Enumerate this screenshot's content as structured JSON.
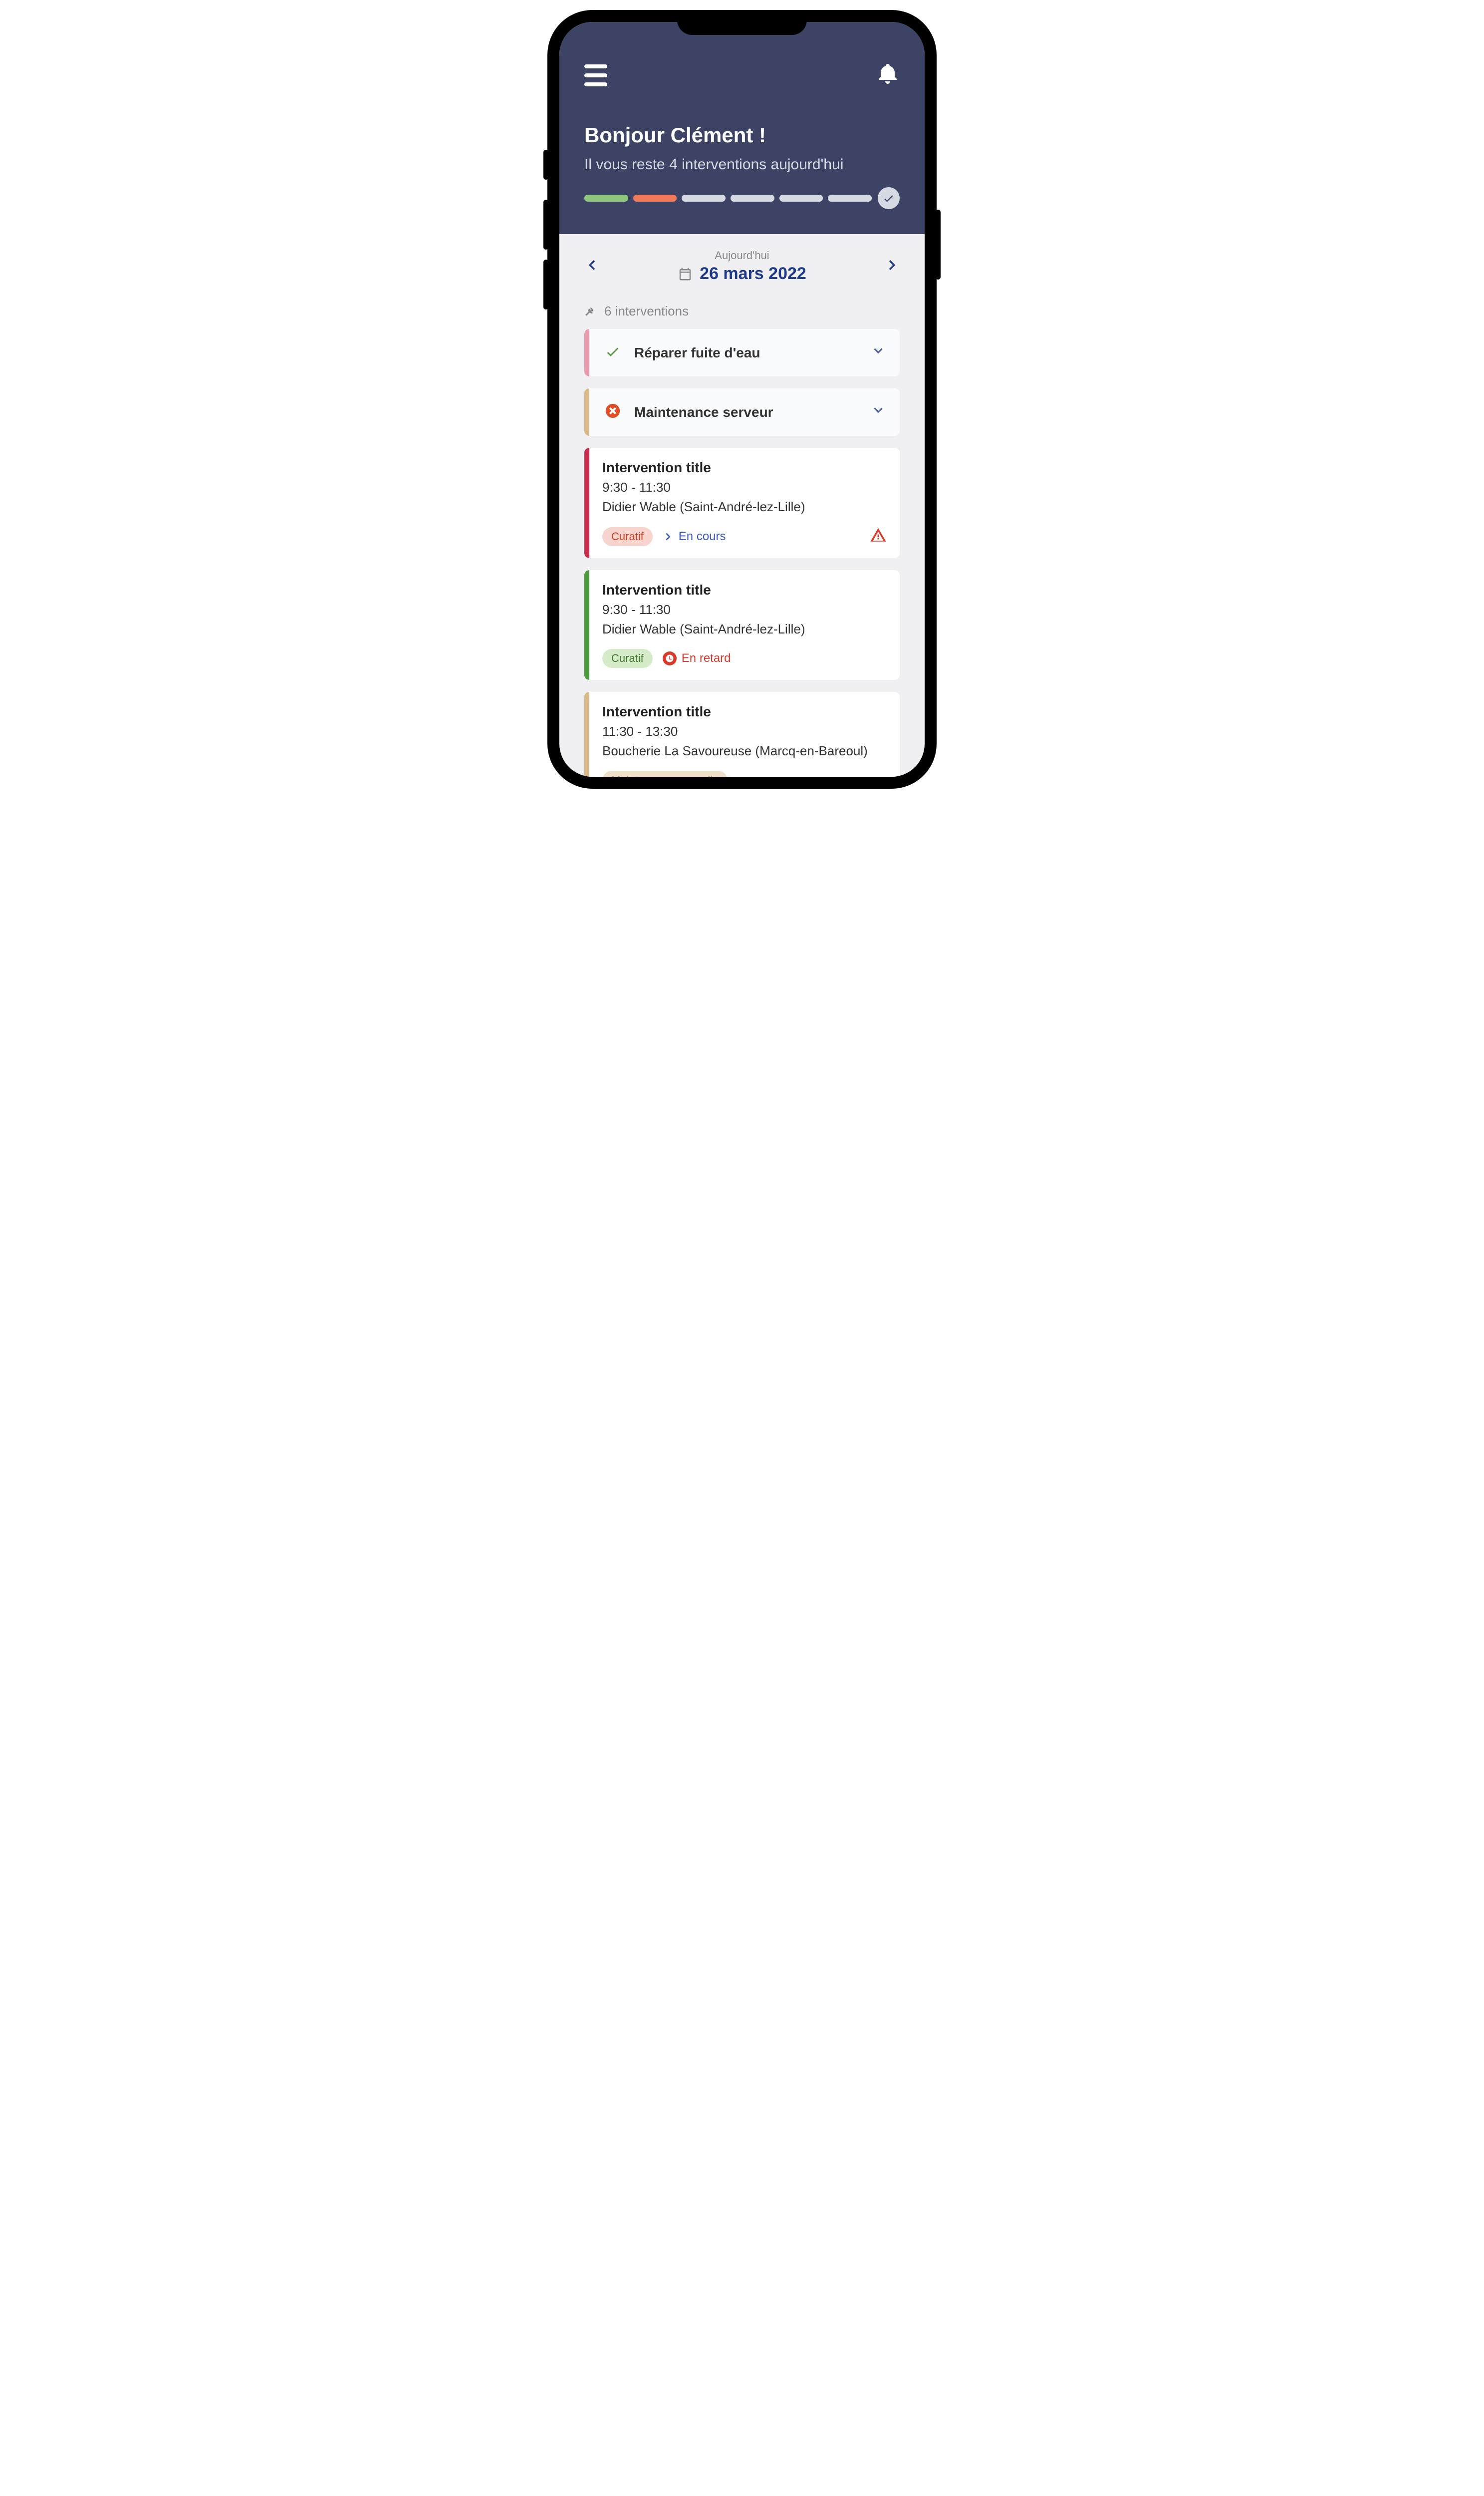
{
  "header": {
    "greeting": "Bonjour Clément !",
    "subtitle": "Il vous reste 4 interventions aujourd'hui",
    "progress": [
      "green",
      "orange",
      "grey",
      "grey",
      "grey",
      "grey"
    ]
  },
  "dateNav": {
    "label": "Aujourd'hui",
    "date": "26 mars 2022"
  },
  "count": "6 interventions",
  "collapsed": [
    {
      "status": "done",
      "title": "Réparer fuite d'eau",
      "border": "pink"
    },
    {
      "status": "fail",
      "title": "Maintenance serveur",
      "border": "tan"
    }
  ],
  "cards": [
    {
      "border": "red",
      "title": "Intervention title",
      "time": "9:30 - 11:30",
      "client": "Didier Wable (Saint-André-lez-Lille)",
      "pill": {
        "label": "Curatif",
        "color": "red"
      },
      "status": {
        "label": "En cours",
        "color": "blue",
        "icon": "chevron"
      },
      "warning": true
    },
    {
      "border": "green",
      "title": "Intervention title",
      "time": "9:30 - 11:30",
      "client": "Didier Wable (Saint-André-lez-Lille)",
      "pill": {
        "label": "Curatif",
        "color": "green"
      },
      "status": {
        "label": "En retard",
        "color": "red",
        "icon": "clock"
      },
      "warning": false
    },
    {
      "border": "tan",
      "title": "Intervention title",
      "time": "11:30 - 13:30",
      "client": "Boucherie La Savoureuse (Marcq-en-Bareoul)",
      "pill": {
        "label": "Maintenance annuelle",
        "color": "tan"
      },
      "status": null,
      "warning": false
    }
  ]
}
